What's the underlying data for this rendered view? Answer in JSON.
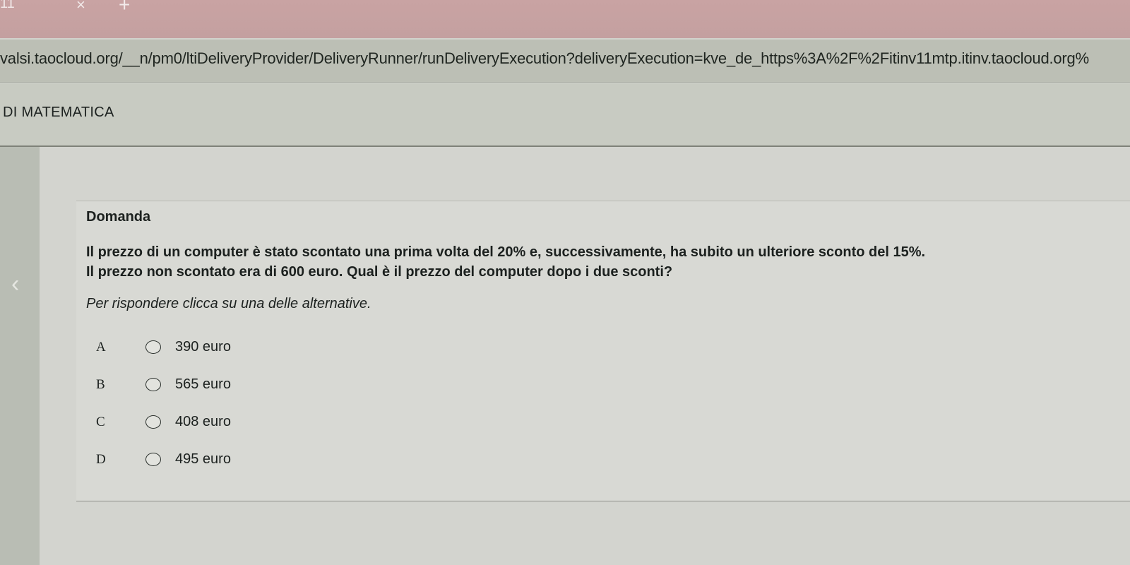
{
  "browser": {
    "tab_number": "11",
    "tab_close": "×",
    "new_tab": "+",
    "url": "valsi.taocloud.org/__n/pm0/ltiDeliveryProvider/DeliveryRunner/runDeliveryExecution?deliveryExecution=kve_de_https%3A%2F%2Fitinv11mtp.itinv.taocloud.org%"
  },
  "header": {
    "title": "DI MATEMATICA"
  },
  "navigation": {
    "prev_arrow": "‹"
  },
  "question": {
    "heading": "Domanda",
    "prompt_lines": [
      "Il prezzo di un computer è stato scontato una prima volta del 20% e, successivamente, ha subito un ulteriore sconto del 15%.",
      "Il prezzo non scontato era di 600 euro. Qual è il prezzo del computer dopo i due sconti?"
    ],
    "instruction": "Per rispondere clicca su una delle alternative.",
    "choices": [
      {
        "letter": "A",
        "label": "390 euro"
      },
      {
        "letter": "B",
        "label": "565 euro"
      },
      {
        "letter": "C",
        "label": "408 euro"
      },
      {
        "letter": "D",
        "label": "495 euro"
      }
    ]
  }
}
